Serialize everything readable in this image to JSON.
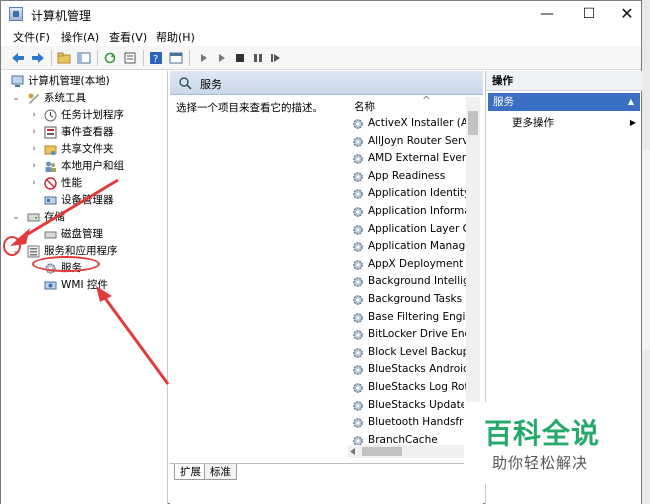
{
  "window": {
    "title": "计算机管理",
    "controls": {
      "minimize": "—",
      "maximize": "☐",
      "close": "✕"
    }
  },
  "menu": [
    {
      "label": "文件(F)"
    },
    {
      "label": "操作(A)"
    },
    {
      "label": "查看(V)"
    },
    {
      "label": "帮助(H)"
    }
  ],
  "toolbar": [
    {
      "icon": "back-arrow-icon"
    },
    {
      "icon": "forward-arrow-icon"
    },
    {
      "icon": "up-folder-icon"
    },
    {
      "icon": "show-hide-tree-icon"
    },
    {
      "icon": "refresh-icon"
    },
    {
      "icon": "export-list-icon"
    },
    {
      "icon": "help-icon"
    },
    {
      "icon": "properties-icon"
    },
    {
      "icon": "start-service-icon"
    },
    {
      "icon": "start-service-alt-icon"
    },
    {
      "icon": "stop-service-icon"
    },
    {
      "icon": "pause-service-icon"
    },
    {
      "icon": "restart-service-icon"
    }
  ],
  "tree": [
    {
      "label": "计算机管理(本地)",
      "icon": "computer-icon",
      "expander": ""
    },
    {
      "label": "系统工具",
      "icon": "tools-icon",
      "expander": "⌄"
    },
    {
      "label": "任务计划程序",
      "icon": "clock-icon",
      "expander": "›"
    },
    {
      "label": "事件查看器",
      "icon": "event-viewer-icon",
      "expander": "›"
    },
    {
      "label": "共享文件夹",
      "icon": "shared-folder-icon",
      "expander": "›"
    },
    {
      "label": "本地用户和组",
      "icon": "users-icon",
      "expander": "›"
    },
    {
      "label": "性能",
      "icon": "performance-icon",
      "expander": "›"
    },
    {
      "label": "设备管理器",
      "icon": "device-manager-icon",
      "expander": ""
    },
    {
      "label": "存储",
      "icon": "storage-icon",
      "expander": "⌄"
    },
    {
      "label": "磁盘管理",
      "icon": "disk-icon",
      "expander": ""
    },
    {
      "label": "服务和应用程序",
      "icon": "services-apps-icon",
      "expander": "⌄"
    },
    {
      "label": "服务",
      "icon": "gear-icon",
      "expander": ""
    },
    {
      "label": "WMI 控件",
      "icon": "wmi-icon",
      "expander": ""
    }
  ],
  "main": {
    "header": "服务",
    "description": "选择一个项目来查看它的描述。",
    "column_name": "名称",
    "sort_indicator": "^",
    "services": [
      "ActiveX Installer (AxInstSV)",
      "AllJoyn Router Service",
      "AMD External Events Utility",
      "App Readiness",
      "Application Identity",
      "Application Information",
      "Application Layer Gateway Service",
      "Application Management",
      "AppX Deployment Service (AppXSVC)",
      "Background Intelligent Transfer Service",
      "Background Tasks Infrastructure Service",
      "Base Filtering Engine",
      "BitLocker Drive Encryption Service",
      "Block Level Backup Engine Service",
      "BlueStacks Android Service",
      "BlueStacks Log Rotator Service",
      "BlueStacks Updater",
      "Bluetooth Handsfree Service",
      "BranchCache"
    ],
    "tabs": [
      {
        "label": "扩展"
      },
      {
        "label": "标准"
      }
    ]
  },
  "actions": {
    "title": "操作",
    "section": "服务",
    "item": "更多操作"
  },
  "watermark": {
    "main": "百科全说",
    "sub": "助你轻松解决"
  },
  "colors": {
    "annotation": "#e23b3b",
    "selection": "#3b6fc2",
    "watermark": "#26a96c"
  }
}
